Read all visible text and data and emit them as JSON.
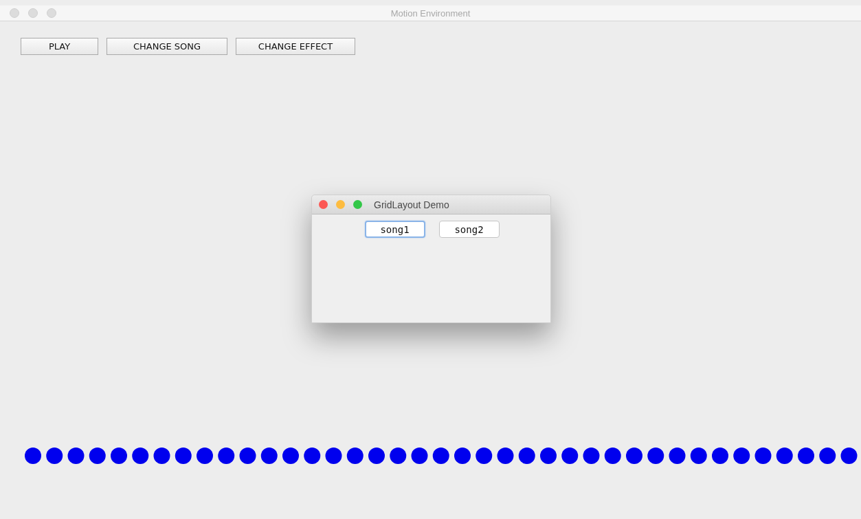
{
  "window": {
    "title": "Motion Environment"
  },
  "toolbar": {
    "buttons": [
      "PLAY",
      "CHANGE SONG",
      "CHANGE EFFECT"
    ]
  },
  "dialog": {
    "title": "GridLayout Demo",
    "buttons": [
      {
        "label": "song1",
        "focused": true
      },
      {
        "label": "song2",
        "focused": false
      }
    ]
  }
}
